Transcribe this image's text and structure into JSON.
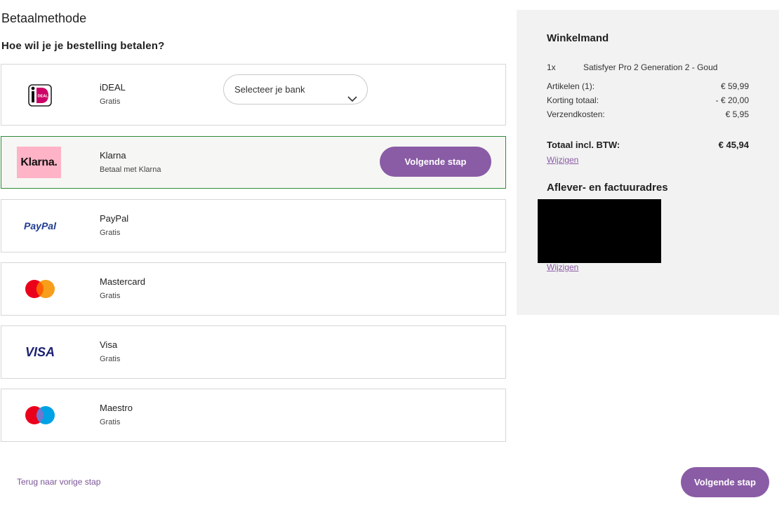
{
  "page": {
    "title": "Betaalmethode",
    "question": "Hoe wil je je bestelling betalen?"
  },
  "methods": [
    {
      "name": "iDEAL",
      "sub": "Gratis",
      "logo": "ideal-logo",
      "select_placeholder": "Selecteer je bank"
    },
    {
      "name": "Klarna",
      "sub": "Betaal met Klarna",
      "logo": "klarna-logo",
      "logo_text": "Klarna.",
      "button": "Volgende stap",
      "selected": true
    },
    {
      "name": "PayPal",
      "sub": "Gratis",
      "logo": "paypal-logo",
      "logo_text": "PayPal"
    },
    {
      "name": "Mastercard",
      "sub": "Gratis",
      "logo": "mastercard-logo"
    },
    {
      "name": "Visa",
      "sub": "Gratis",
      "logo": "visa-logo",
      "logo_text": "VISA"
    },
    {
      "name": "Maestro",
      "sub": "Gratis",
      "logo": "maestro-logo"
    }
  ],
  "footer": {
    "back_link": "Terug naar vorige stap",
    "next_button": "Volgende stap"
  },
  "summary": {
    "title": "Winkelmand",
    "item_qty": "1x",
    "item_name": "Satisfyer Pro 2 Generation 2 - Goud",
    "rows": [
      {
        "label": "Artikelen (1):",
        "value": "€ 59,99"
      },
      {
        "label": "Korting totaal:",
        "value": "- € 20,00"
      },
      {
        "label": "Verzendkosten:",
        "value": "€ 5,95"
      }
    ],
    "total_label": "Totaal incl. BTW:",
    "total_value": "€ 45,94",
    "change_link_1": "Wijzigen",
    "address_title": "Aflever- en factuuradres",
    "change_link_2": "Wijzigen"
  },
  "colors": {
    "brand": "#8a5ca5",
    "selected_border": "#2e8b3a",
    "klarna_pink": "#ffb3c7"
  }
}
